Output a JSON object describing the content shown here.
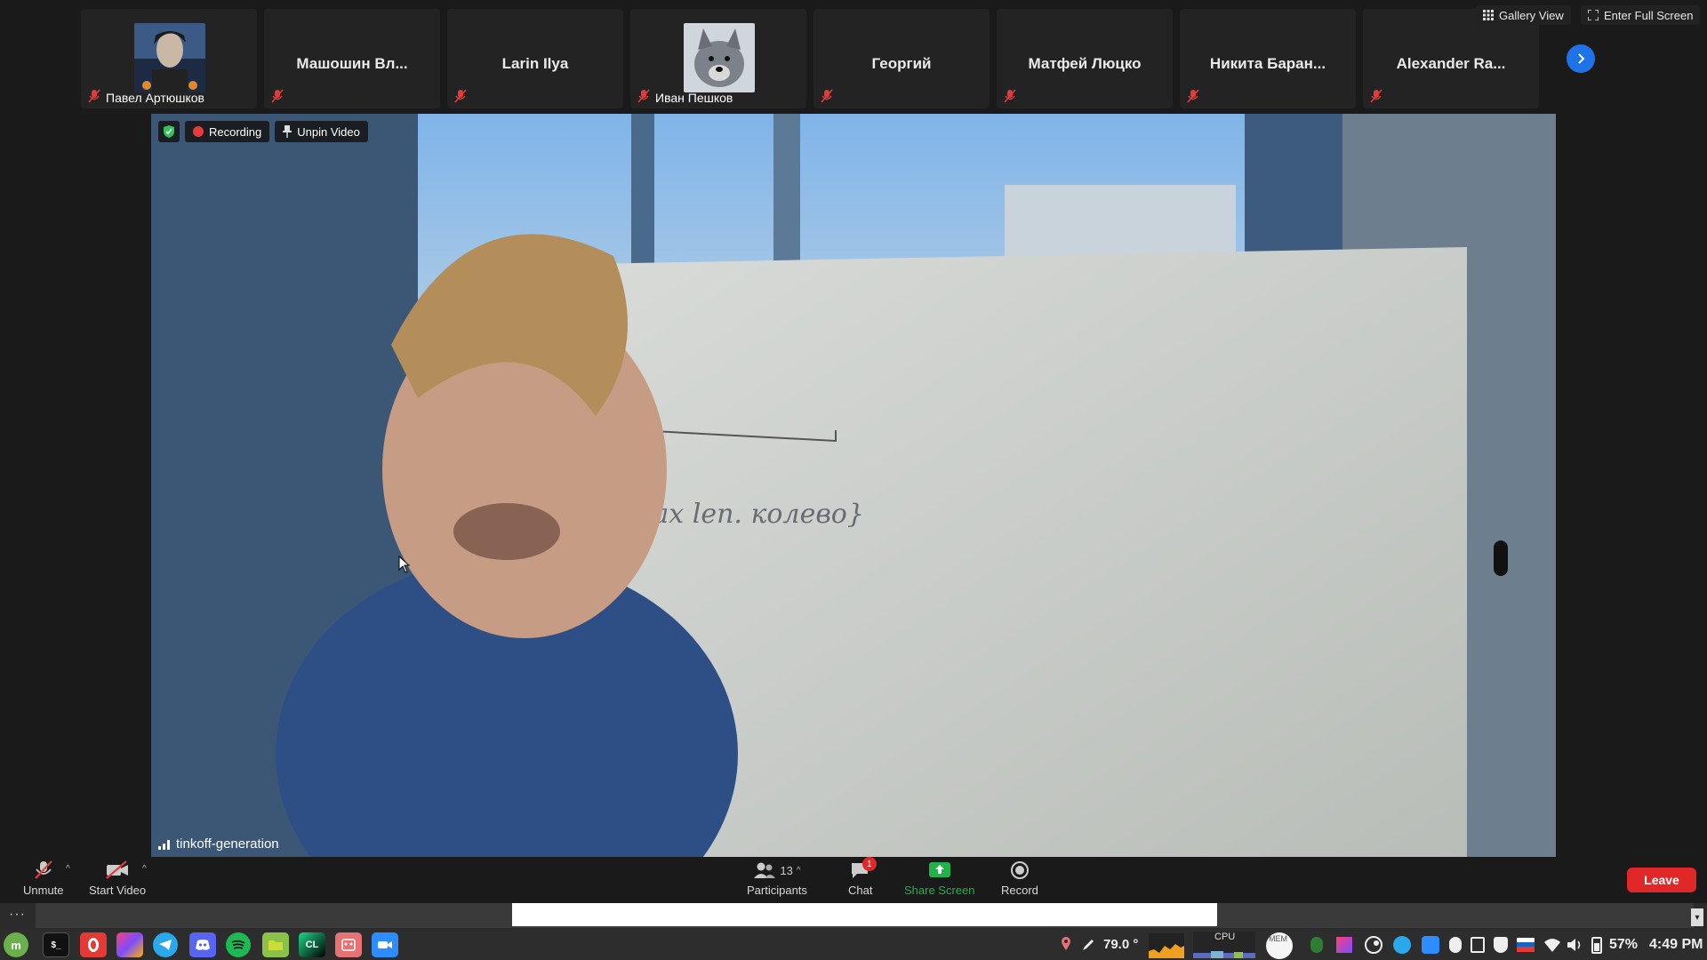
{
  "topbar": {
    "participants": [
      {
        "name": "Павел Артюшков",
        "style": "avatar"
      },
      {
        "name": "Машошин Вл...",
        "style": "text"
      },
      {
        "name": "Larin Ilya",
        "style": "text"
      },
      {
        "name": "Иван Пешков",
        "style": "avatar"
      },
      {
        "name": "Георгий",
        "style": "text"
      },
      {
        "name": "Матфей Люцко",
        "style": "text"
      },
      {
        "name": "Никита Баран...",
        "style": "text"
      },
      {
        "name": "Alexander Ra...",
        "style": "text"
      }
    ],
    "gallery_view_label": "Gallery View",
    "fullscreen_label": "Enter Full Screen"
  },
  "video": {
    "recording_label": "Recording",
    "unpin_label": "Unpin Video",
    "speaker_label": "tinkoff-generation"
  },
  "toolbar": {
    "unmute_label": "Unmute",
    "start_video_label": "Start Video",
    "participants_label": "Participants",
    "participants_count": "13",
    "chat_label": "Chat",
    "chat_badge": "1",
    "share_label": "Share Screen",
    "record_label": "Record",
    "leave_label": "Leave"
  },
  "strip": {
    "dots": "···"
  },
  "taskbar": {
    "apps": [
      "mint-menu-icon",
      "terminal-icon",
      "opera-icon",
      "jetbrains-icon",
      "telegram-icon",
      "discord-icon",
      "spotify-icon",
      "files-icon",
      "clion-icon",
      "app-icon",
      "zoom-icon"
    ],
    "terminal_text": "$_",
    "clion_text": "CL",
    "temperature": "79.0 °",
    "cpu_label": "CPU",
    "mem_label": "MEM",
    "battery": "57%",
    "time": "4:49 PM"
  },
  "colors": {
    "accent_blue": "#1e73e8",
    "leave_red": "#e02828",
    "share_green": "#22b14c",
    "mic_muted_red": "#e23b3b"
  }
}
